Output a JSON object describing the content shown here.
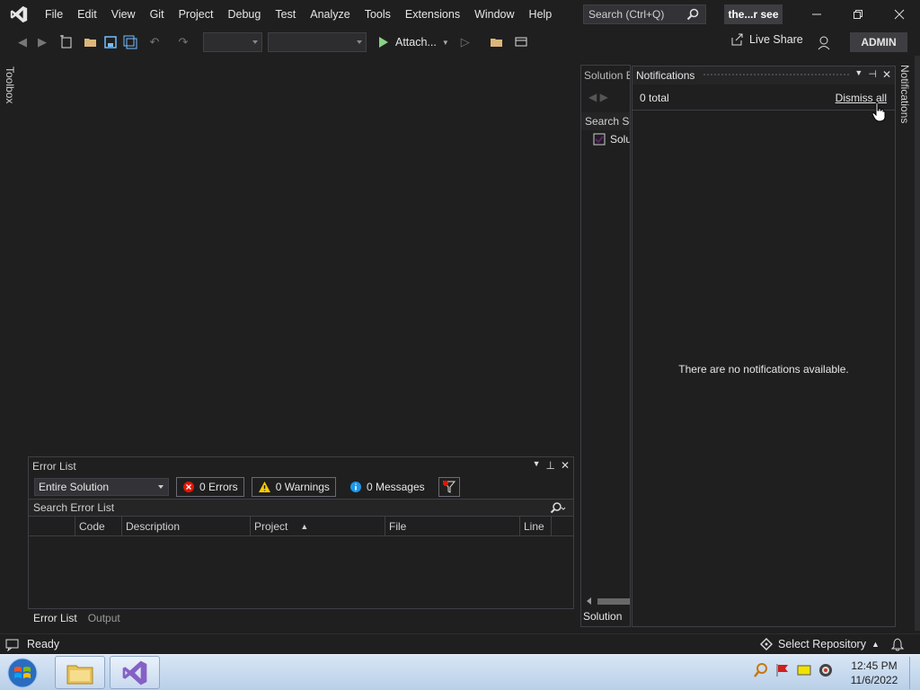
{
  "menu": {
    "items": [
      "File",
      "Edit",
      "View",
      "Git",
      "Project",
      "Debug",
      "Test",
      "Analyze",
      "Tools",
      "Extensions",
      "Window",
      "Help"
    ]
  },
  "search": {
    "placeholder": "Search (Ctrl+Q)"
  },
  "solution_badge": "the...r see",
  "toolbar": {
    "attach_label": "Attach...",
    "live_share_label": "Live Share",
    "account_label": "ADMIN"
  },
  "toolbox_tab": "Toolbox",
  "error_list": {
    "title": "Error List",
    "scope": "Entire Solution",
    "errors_label": "0 Errors",
    "warnings_label": "0 Warnings",
    "messages_label": "0 Messages",
    "search_placeholder": "Search Error List",
    "columns": [
      "Code",
      "Description",
      "Project",
      "File",
      "Line"
    ]
  },
  "bottom_tabs": [
    "Error List",
    "Output"
  ],
  "solution_explorer": {
    "title": "Solution E",
    "search": "Search So",
    "item": "Solu",
    "footer": "Solution"
  },
  "notifications": {
    "title": "Notifications",
    "count": "0 total",
    "dismiss": "Dismiss all",
    "empty": "There are no notifications available.",
    "side_tab": "Notifications"
  },
  "status": {
    "left": "Ready",
    "repo": "Select Repository"
  },
  "taskbar": {
    "time": "12:45 PM",
    "date": "11/6/2022"
  },
  "colors": {
    "accent": "#68217a",
    "error": "#e51400",
    "warning": "#ffcc00",
    "info": "#1c97ea"
  }
}
